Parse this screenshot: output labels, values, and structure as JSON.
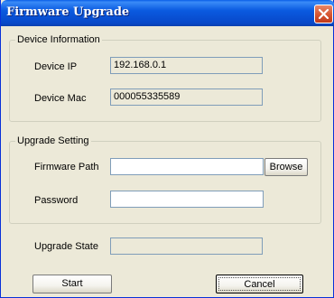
{
  "window": {
    "title": "Firmware Upgrade",
    "close_icon": "close-icon"
  },
  "device_info": {
    "legend": "Device Information",
    "ip_label": "Device IP",
    "ip_value": "192.168.0.1",
    "mac_label": "Device Mac",
    "mac_value": "000055335589"
  },
  "upgrade_setting": {
    "legend": "Upgrade Setting",
    "firmware_path_label": "Firmware Path",
    "firmware_path_value": "",
    "browse_label": "Browse",
    "password_label": "Password",
    "password_value": ""
  },
  "upgrade_state": {
    "label": "Upgrade State",
    "value": ""
  },
  "buttons": {
    "start_label": "Start",
    "cancel_label": "Cancel"
  }
}
